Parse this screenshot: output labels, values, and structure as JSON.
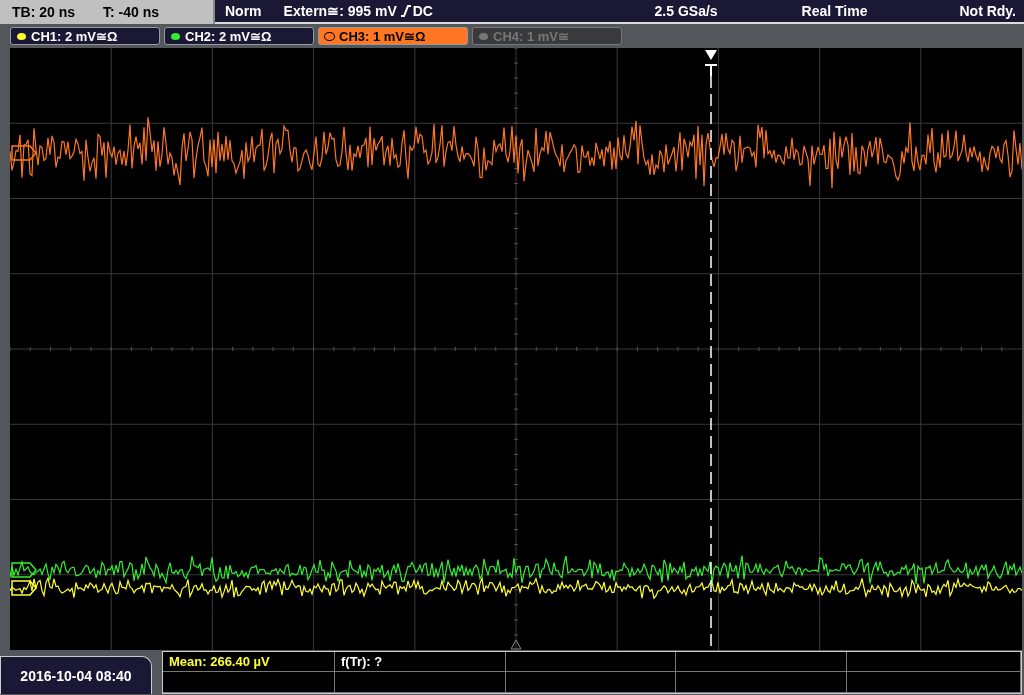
{
  "status_bar": {
    "timebase": "TB: 20 ns",
    "trigger_time": "T: -40 ns",
    "trigger_mode": "Norm",
    "trigger_source": "Extern≅: 995 mV",
    "trigger_coupling": "DC",
    "sample_rate": "2.5 GSa/s",
    "acquisition_mode": "Real Time",
    "run_state": "Not Rdy."
  },
  "channels": [
    {
      "label": "CH1: 2 mV≅Ω",
      "color": "#ffff33",
      "selected": false,
      "disabled": false
    },
    {
      "label": "CH2: 2 mV≅Ω",
      "color": "#33ee33",
      "selected": false,
      "disabled": false
    },
    {
      "label": "CH3: 1 mV≅Ω",
      "color": "#ff7722",
      "selected": true,
      "disabled": false
    },
    {
      "label": "CH4: 1 mV≅",
      "color": "#777777",
      "selected": false,
      "disabled": true
    }
  ],
  "date_time": "2016-10-04 08:40",
  "measurements": [
    {
      "text": "Mean: 266.40 µV",
      "kind": "channel"
    },
    {
      "text": "f(Tr): ?",
      "kind": "plain"
    }
  ]
}
